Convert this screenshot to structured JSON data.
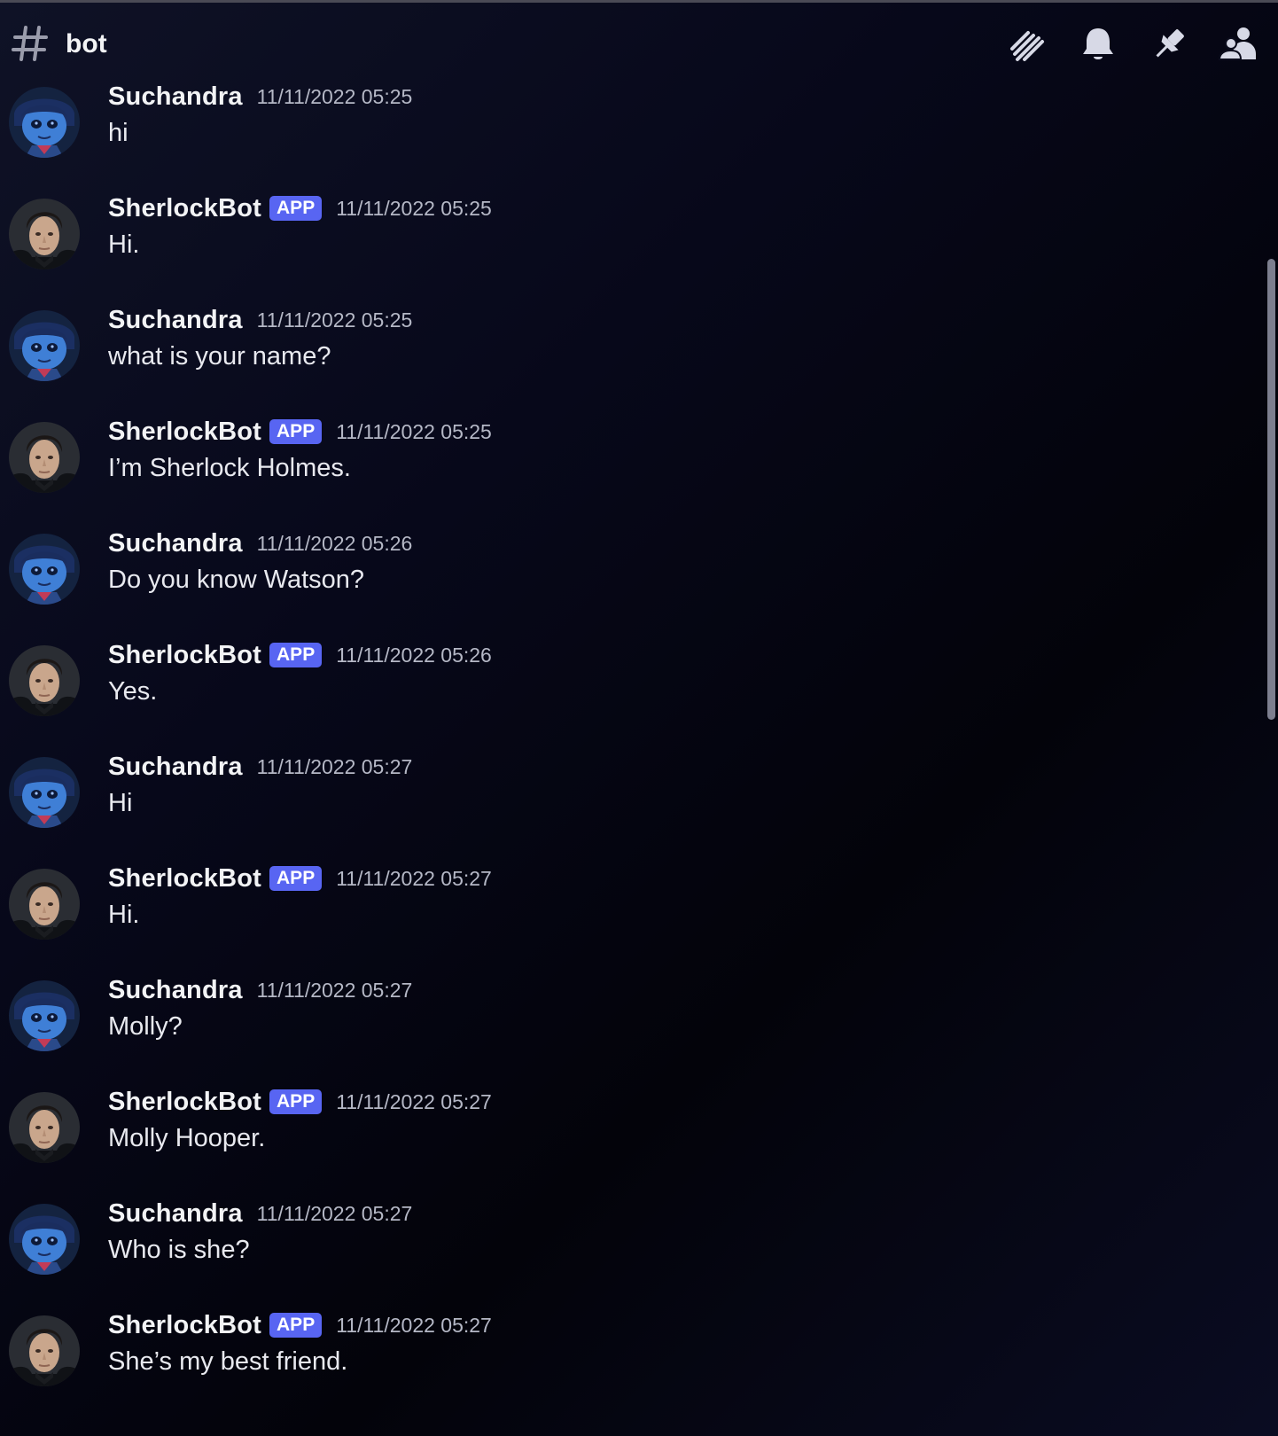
{
  "header": {
    "channel_name": "bot"
  },
  "toolbar": {
    "icons": [
      "threads-icon",
      "bell-icon",
      "pin-icon",
      "members-icon"
    ]
  },
  "colors": {
    "accent": "#5865f2",
    "background": "#05050c"
  },
  "messages": [
    {
      "author": "Suchandra",
      "is_bot": false,
      "timestamp": "11/11/2022 05:25",
      "text": "hi"
    },
    {
      "author": "SherlockBot",
      "is_bot": true,
      "badge": "APP",
      "timestamp": "11/11/2022 05:25",
      "text": "Hi."
    },
    {
      "author": "Suchandra",
      "is_bot": false,
      "timestamp": "11/11/2022 05:25",
      "text": "what is your name?"
    },
    {
      "author": "SherlockBot",
      "is_bot": true,
      "badge": "APP",
      "timestamp": "11/11/2022 05:25",
      "text": "I’m Sherlock Holmes."
    },
    {
      "author": "Suchandra",
      "is_bot": false,
      "timestamp": "11/11/2022 05:26",
      "text": "Do you know Watson?"
    },
    {
      "author": "SherlockBot",
      "is_bot": true,
      "badge": "APP",
      "timestamp": "11/11/2022 05:26",
      "text": "Yes."
    },
    {
      "author": "Suchandra",
      "is_bot": false,
      "timestamp": "11/11/2022 05:27",
      "text": "Hi"
    },
    {
      "author": "SherlockBot",
      "is_bot": true,
      "badge": "APP",
      "timestamp": "11/11/2022 05:27",
      "text": "Hi."
    },
    {
      "author": "Suchandra",
      "is_bot": false,
      "timestamp": "11/11/2022 05:27",
      "text": "Molly?"
    },
    {
      "author": "SherlockBot",
      "is_bot": true,
      "badge": "APP",
      "timestamp": "11/11/2022 05:27",
      "text": "Molly Hooper."
    },
    {
      "author": "Suchandra",
      "is_bot": false,
      "timestamp": "11/11/2022 05:27",
      "text": "Who is she?"
    },
    {
      "author": "SherlockBot",
      "is_bot": true,
      "badge": "APP",
      "timestamp": "11/11/2022 05:27",
      "text": "She’s my best friend."
    }
  ]
}
